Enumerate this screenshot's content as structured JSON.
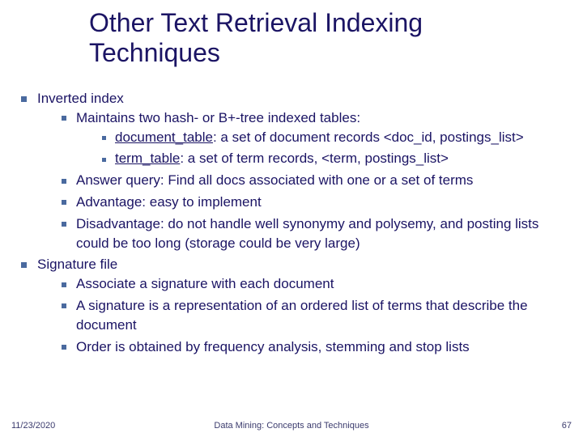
{
  "title": "Other Text Retrieval Indexing Techniques",
  "bullets": {
    "inverted": {
      "label": "Inverted index",
      "maintains": "Maintains two hash- or B+-tree indexed tables:",
      "doc_table_name": "document_table",
      "doc_table_rest": ": a set of document records <doc_id, postings_list>",
      "term_table_name": "term_table",
      "term_table_rest": ": a set of term records, <term, postings_list>",
      "answer": "Answer query: Find all docs associated with one or a set of terms",
      "advantage": "Advantage: easy to implement",
      "disadvantage": "Disadvantage: do not handle well synonymy and polysemy, and posting lists could be too long (storage could be very large)"
    },
    "signature": {
      "label": "Signature file",
      "associate": "Associate a signature with each document",
      "sig_is": "A signature is a representation of an ordered list of terms that describe the document",
      "order": "Order is obtained by frequency analysis, stemming and stop lists"
    }
  },
  "footer": {
    "date": "11/23/2020",
    "center": "Data Mining: Concepts and Techniques",
    "page": "67"
  }
}
